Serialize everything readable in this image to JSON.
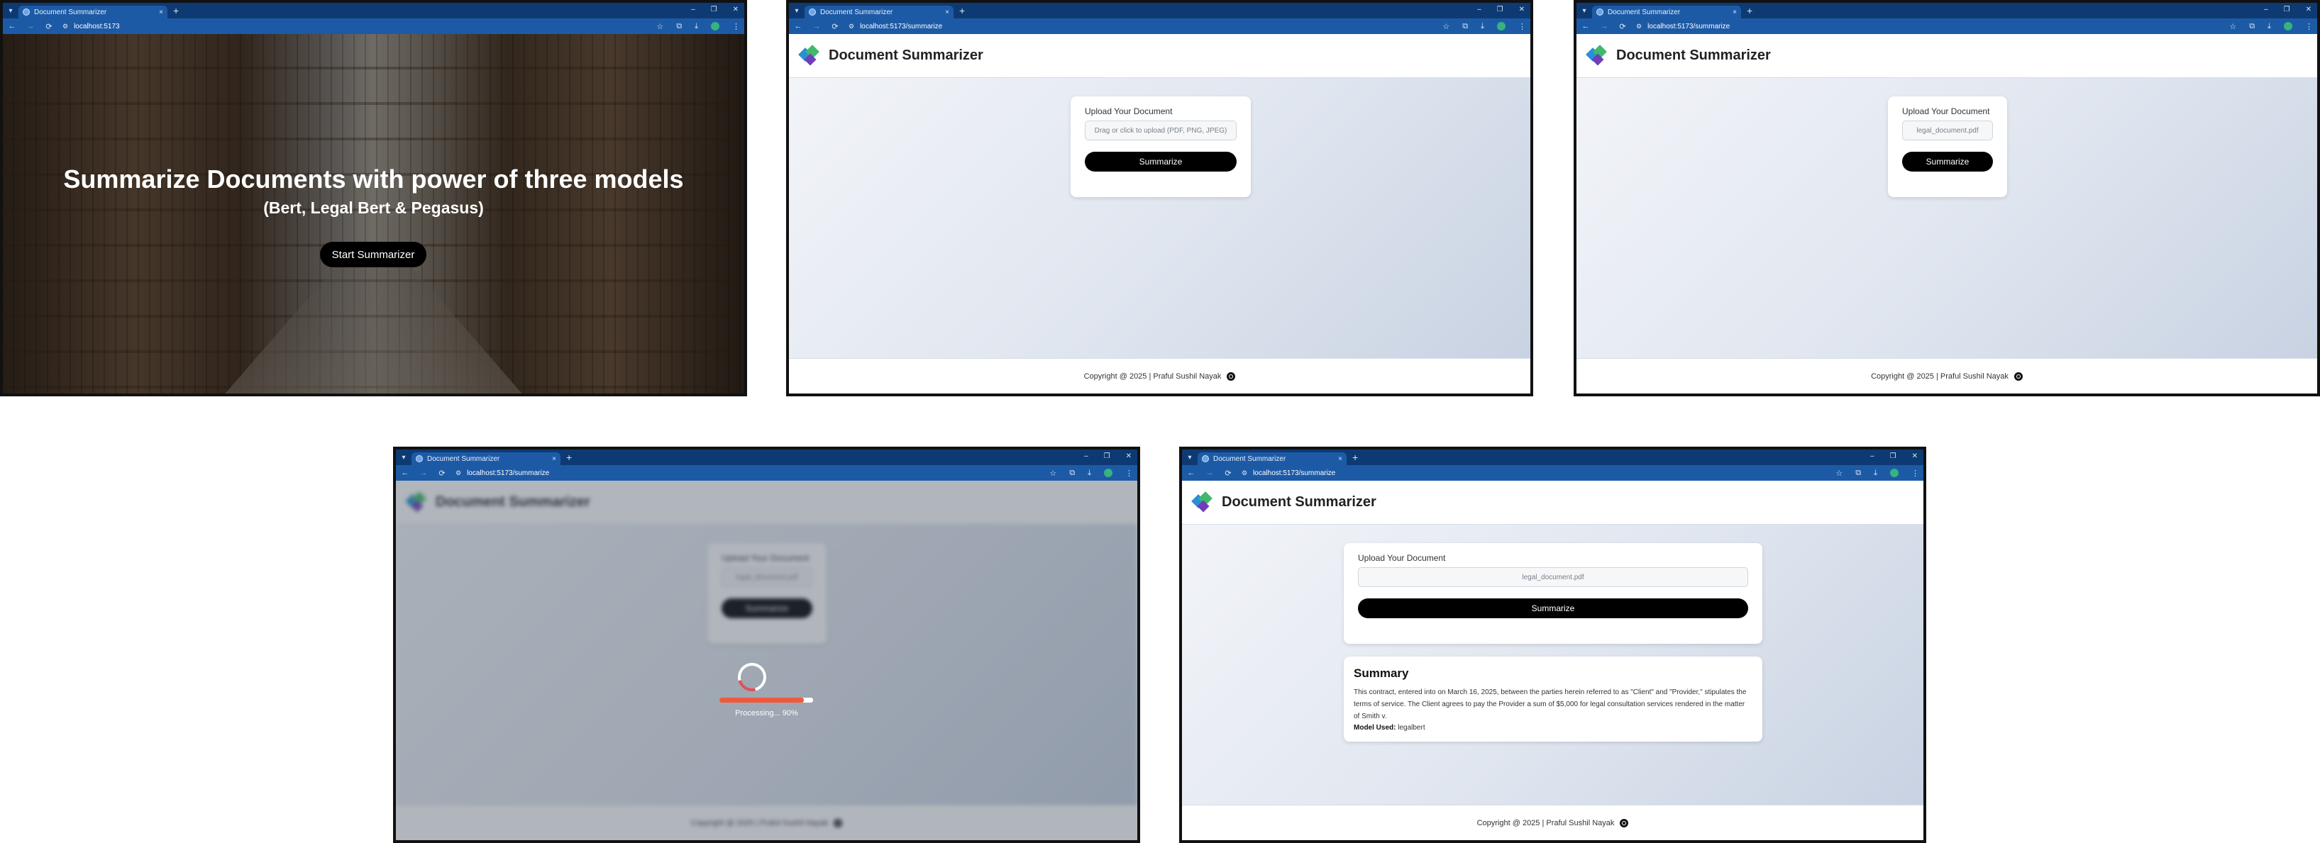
{
  "browser": {
    "tab_title": "Document Summarizer",
    "tab_close": "×",
    "new_tab": "+",
    "window_controls": [
      "–",
      "❐",
      "✕"
    ],
    "nav": {
      "back": "←",
      "forward": "→",
      "reload": "⟳"
    },
    "url_home": "localhost:5173",
    "url_app": "localhost:5173/summarize"
  },
  "landing": {
    "title": "Summarize Documents with power of three models",
    "subtitle": "(Bert, Legal Bert & Pegasus)",
    "cta": "Start Summarizer"
  },
  "app": {
    "title": "Document Summarizer",
    "upload_label": "Upload Your Document",
    "upload_placeholder": "Drag or click to upload (PDF, PNG, JPEG)",
    "uploaded_file": "legal_document.pdf",
    "summarize_button": "Summarize",
    "footer": "Copyright @ 2025 | Praful Sushil Nayak"
  },
  "processing": {
    "label": "Processing... 90%",
    "progress": 0.9
  },
  "summary": {
    "heading": "Summary",
    "text": "This contract, entered into on March 16, 2025, between the parties herein referred to as \"Client\" and \"Provider,\" stipulates the terms of service. The Client agrees to pay the Provider a sum of $5,000 for legal consultation services rendered in the matter of Smith v.",
    "model_label": "Model Used:",
    "model_value": "legalbert"
  },
  "colors": {
    "tabbar": "#0e3a73",
    "toolbar": "#1d5aa6",
    "button": "#000000",
    "progress": "#f05a3c"
  }
}
